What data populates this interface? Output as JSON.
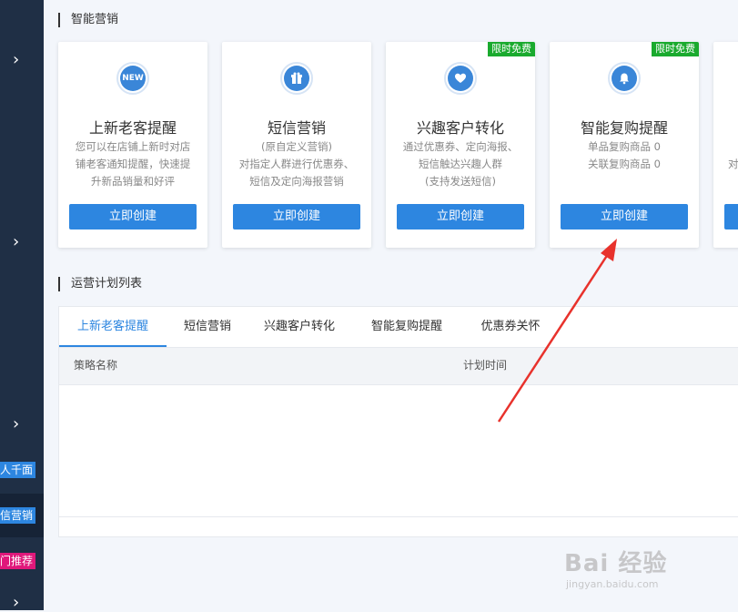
{
  "sidebar": {
    "tags": [
      {
        "label": "人千面",
        "bg": "#2d86e0"
      },
      {
        "label": "信营销",
        "bg": "#2d86e0"
      },
      {
        "label": "门推荐",
        "bg": "#e0187a"
      }
    ]
  },
  "marketing": {
    "section_title": "智能营销",
    "cards": [
      {
        "icon": "new-icon",
        "icon_text": "NEW",
        "title": "上新老客提醒",
        "desc": [
          "您可以在店铺上新时对店",
          "铺老客通知提醒，快速提",
          "升新品销量和好评"
        ],
        "button": "立即创建",
        "badge": ""
      },
      {
        "icon": "gift-icon",
        "title": "短信营销",
        "desc": [
          "(原自定义营销)",
          "对指定人群进行优惠券、",
          "短信及定向海报营销"
        ],
        "button": "立即创建",
        "badge": ""
      },
      {
        "icon": "heart-icon",
        "title": "兴趣客户转化",
        "desc": [
          "通过优惠券、定向海报、",
          "短信触达兴趣人群",
          "(支持发送短信)"
        ],
        "button": "立即创建",
        "badge": "限时免费"
      },
      {
        "icon": "bell-icon",
        "title": "智能复购提醒",
        "desc": [
          "单品复购商品 0",
          "关联复购商品 0"
        ],
        "button": "立即创建",
        "badge": "限时免费"
      },
      {
        "icon": "",
        "title": "",
        "desc": [
          "",
          "对"
        ],
        "button": "",
        "badge": ""
      }
    ]
  },
  "plans": {
    "section_title": "运营计划列表",
    "tabs": [
      "上新老客提醒",
      "短信营销",
      "兴趣客户转化",
      "智能复购提醒",
      "优惠券关怀"
    ],
    "active_tab": 0,
    "columns": [
      "策略名称",
      "计划时间"
    ]
  },
  "watermark": {
    "main": "Bai 经验",
    "sub": "jingyan.baidu.com"
  },
  "colors": {
    "accent": "#2d86e0",
    "sidebar": "#1f2f45",
    "badge": "#1aaa2e",
    "arrow": "#e8322c"
  }
}
